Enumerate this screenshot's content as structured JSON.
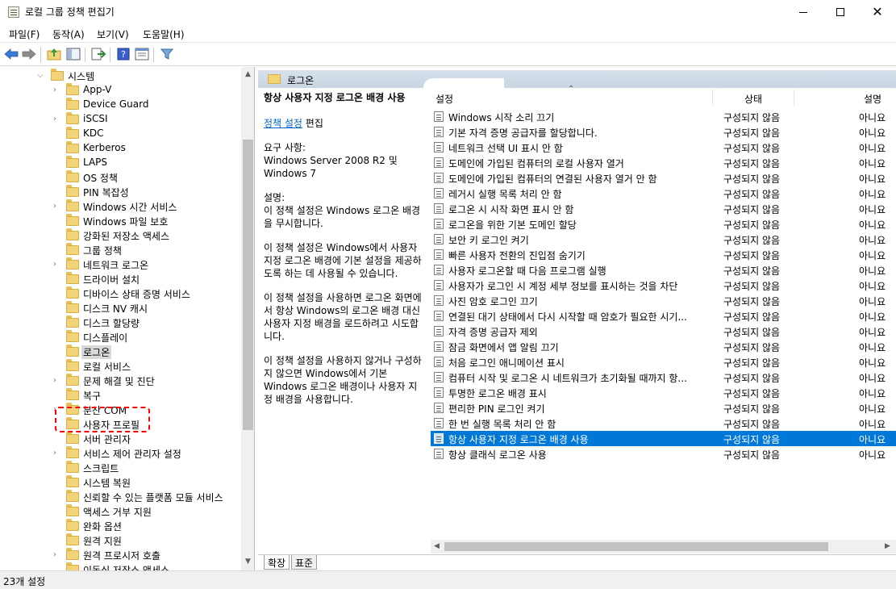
{
  "window": {
    "title": "로컬 그룹 정책 편집기",
    "minimize": "—",
    "maximize": "☐",
    "close": "✕"
  },
  "menu": {
    "items": [
      {
        "label": "파일(F)"
      },
      {
        "label": "동작(A)"
      },
      {
        "label": "보기(V)"
      },
      {
        "label": "도움말(H)"
      }
    ]
  },
  "toolbar": {
    "icons": [
      "back-arrow-icon",
      "forward-arrow-icon",
      "up-folder-icon",
      "show-hide-tree-icon",
      "export-list-icon",
      "help-icon",
      "properties-icon",
      "filter-icon"
    ]
  },
  "tree": {
    "parent": {
      "label": "시스템",
      "expanded": true
    },
    "items": [
      {
        "label": "App-V",
        "expandable": true
      },
      {
        "label": "Device Guard",
        "expandable": false
      },
      {
        "label": "iSCSI",
        "expandable": true
      },
      {
        "label": "KDC",
        "expandable": false
      },
      {
        "label": "Kerberos",
        "expandable": false
      },
      {
        "label": "LAPS",
        "expandable": false
      },
      {
        "label": "OS 정책",
        "expandable": false
      },
      {
        "label": "PIN 복잡성",
        "expandable": false
      },
      {
        "label": "Windows 시간 서비스",
        "expandable": true
      },
      {
        "label": "Windows 파일 보호",
        "expandable": false
      },
      {
        "label": "강화된 저장소 액세스",
        "expandable": false
      },
      {
        "label": "그룹 정책",
        "expandable": false
      },
      {
        "label": "네트워크 로그온",
        "expandable": true
      },
      {
        "label": "드라이버 설치",
        "expandable": false
      },
      {
        "label": "디바이스 상태 증명 서비스",
        "expandable": false
      },
      {
        "label": "디스크 NV 캐시",
        "expandable": false
      },
      {
        "label": "디스크 할당량",
        "expandable": false
      },
      {
        "label": "디스플레이",
        "expandable": false
      },
      {
        "label": "로그온",
        "expandable": false,
        "selected": true
      },
      {
        "label": "로컬 서비스",
        "expandable": false
      },
      {
        "label": "문제 해결 및 진단",
        "expandable": true
      },
      {
        "label": "복구",
        "expandable": false
      },
      {
        "label": "분산 COM",
        "expandable": true
      },
      {
        "label": "사용자 프로필",
        "expandable": false
      },
      {
        "label": "서버 관리자",
        "expandable": false
      },
      {
        "label": "서비스 제어 관리자 설정",
        "expandable": true
      },
      {
        "label": "스크립트",
        "expandable": false
      },
      {
        "label": "시스템 복원",
        "expandable": false
      },
      {
        "label": "신뢰할 수 있는 플랫폼 모듈 서비스",
        "expandable": false
      },
      {
        "label": "액세스 거부 지원",
        "expandable": false
      },
      {
        "label": "완화 옵션",
        "expandable": false
      },
      {
        "label": "원격 지원",
        "expandable": false
      },
      {
        "label": "원격 프로시저 호출",
        "expandable": true
      },
      {
        "label": "이동식 저장소 액세스",
        "expandable": false
      }
    ]
  },
  "right": {
    "header_label": "로그온",
    "description": {
      "title": "항상 사용자 지정 로그온 배경 사용",
      "edit_link": "정책 설정",
      "edit_suffix": " 편집",
      "requirements_label": "요구 사항:",
      "requirements": "Windows Server 2008 R2 및 Windows 7",
      "desc_label": "설명:",
      "paragraphs": [
        "이 정책 설정은 Windows 로그온 배경을 무시합니다.",
        "이 정책 설정은 Windows에서 사용자 지정 로그온 배경에 기본 설정을 제공하도록 하는 데 사용될 수 있습니다.",
        "이 정책 설정을 사용하면 로그온 화면에서 항상 Windows의 로그온 배경 대신 사용자 지정 배경을 로드하려고 시도합니다.",
        "이 정책 설정을 사용하지 않거나 구성하지 않으면 Windows에서 기본 Windows 로그온 배경이나 사용자 지정 배경을 사용합니다."
      ]
    },
    "columns": {
      "name": "설정",
      "state": "상태",
      "note": "설명"
    },
    "rows": [
      {
        "name": "Windows 시작 소리 끄기",
        "state": "구성되지 않음",
        "note": "아니요"
      },
      {
        "name": "기본 자격 증명 공급자를 할당합니다.",
        "state": "구성되지 않음",
        "note": "아니요"
      },
      {
        "name": "네트워크 선택 UI 표시 안 함",
        "state": "구성되지 않음",
        "note": "아니요"
      },
      {
        "name": "도메인에 가입된 컴퓨터의 로컬 사용자 열거",
        "state": "구성되지 않음",
        "note": "아니요"
      },
      {
        "name": "도메인에 가입된 컴퓨터의 연결된 사용자 열거 안 함",
        "state": "구성되지 않음",
        "note": "아니요"
      },
      {
        "name": "레거시 실행 목록 처리 안 함",
        "state": "구성되지 않음",
        "note": "아니요"
      },
      {
        "name": "로그온 시 시작 화면 표시 안 함",
        "state": "구성되지 않음",
        "note": "아니요"
      },
      {
        "name": "로그온을 위한 기본 도메인 할당",
        "state": "구성되지 않음",
        "note": "아니요"
      },
      {
        "name": "보안 키 로그인 켜기",
        "state": "구성되지 않음",
        "note": "아니요"
      },
      {
        "name": "빠른 사용자 전환의 진입점 숨기기",
        "state": "구성되지 않음",
        "note": "아니요"
      },
      {
        "name": "사용자 로그온할 때 다음 프로그램 실행",
        "state": "구성되지 않음",
        "note": "아니요"
      },
      {
        "name": "사용자가 로그인 시 계정 세부 정보를 표시하는 것을 차단",
        "state": "구성되지 않음",
        "note": "아니요"
      },
      {
        "name": "사진 암호 로그인 끄기",
        "state": "구성되지 않음",
        "note": "아니요"
      },
      {
        "name": "연결된 대기 상태에서 다시 시작할 때 암호가 필요한 시기...",
        "state": "구성되지 않음",
        "note": "아니요"
      },
      {
        "name": "자격 증명 공급자 제외",
        "state": "구성되지 않음",
        "note": "아니요"
      },
      {
        "name": "잠금 화면에서 앱 알림 끄기",
        "state": "구성되지 않음",
        "note": "아니요"
      },
      {
        "name": "처음 로그인 애니메이션 표시",
        "state": "구성되지 않음",
        "note": "아니요"
      },
      {
        "name": "컴퓨터 시작 및 로그온 시 네트워크가 초기화될 때까지 항...",
        "state": "구성되지 않음",
        "note": "아니요"
      },
      {
        "name": "투명한 로그온 배경 표시",
        "state": "구성되지 않음",
        "note": "아니요"
      },
      {
        "name": "편리한 PIN 로그인 켜기",
        "state": "구성되지 않음",
        "note": "아니요"
      },
      {
        "name": "한 번 실행 목록 처리 안 함",
        "state": "구성되지 않음",
        "note": "아니요"
      },
      {
        "name": "항상 사용자 지정 로그온 배경 사용",
        "state": "구성되지 않음",
        "note": "아니요",
        "selected": true
      },
      {
        "name": "항상 클래식 로그온 사용",
        "state": "구성되지 않음",
        "note": "아니요"
      }
    ],
    "tabs": {
      "extended": "확장",
      "standard": "표준"
    }
  },
  "status": {
    "text": "23개 설정"
  },
  "colors": {
    "selection": "#0078d7",
    "header_band": "#d6e1ec",
    "highlight_box": "#ff0000"
  }
}
